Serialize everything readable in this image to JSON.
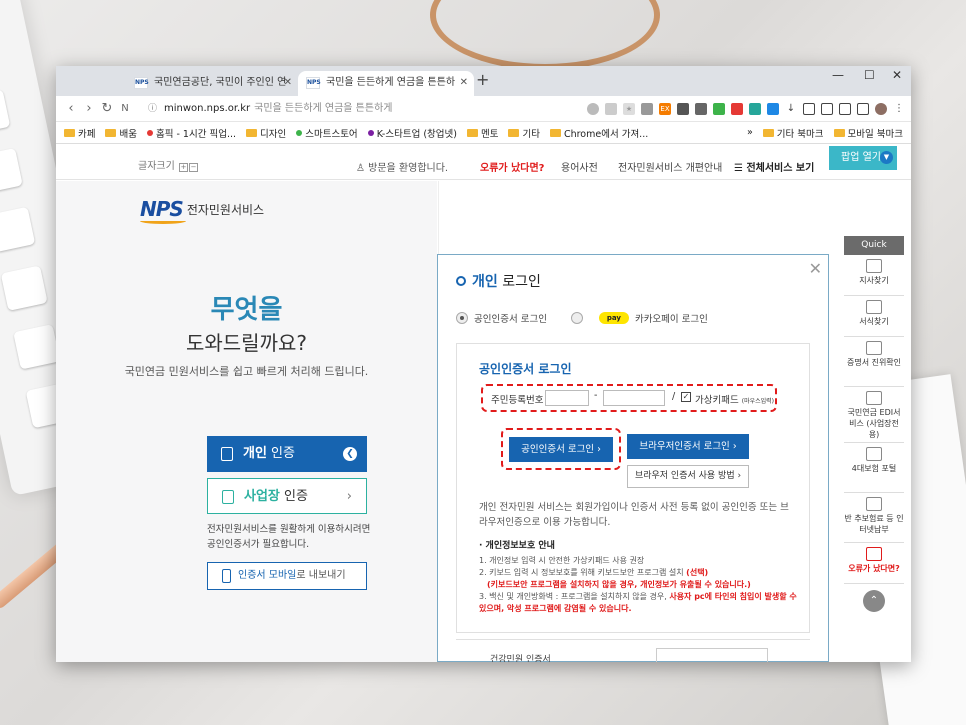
{
  "tabs": [
    {
      "label": "국민연금공단, 국민이 주인인 연",
      "active": false
    },
    {
      "label": "국민을 든든하게 연금을 튼튼하",
      "active": true
    }
  ],
  "toolbar": {
    "url": "minwon.nps.or.kr",
    "page_title_hint": "국민을 든든하게 연금을 튼튼하게"
  },
  "bookmarks": [
    {
      "label": "카페",
      "icon": "folder-icon"
    },
    {
      "label": "배움",
      "icon": "folder-icon"
    },
    {
      "label": "홈픽 - 1시간 픽업...",
      "icon": "dot-icon"
    },
    {
      "label": "디자인",
      "icon": "folder-icon"
    },
    {
      "label": "스마트스토어",
      "icon": "dot-icon"
    },
    {
      "label": "K-스타트업 (창업넷)",
      "icon": "dot-icon"
    },
    {
      "label": "멘토",
      "icon": "folder-icon"
    },
    {
      "label": "기타",
      "icon": "folder-icon"
    },
    {
      "label": "Chrome에서 가져...",
      "icon": "folder-icon"
    }
  ],
  "bookmarks_right": [
    {
      "label": "»"
    },
    {
      "label": "기타 북마크"
    },
    {
      "label": "모바일 북마크"
    }
  ],
  "topbar": {
    "font_size_label": "글자크기",
    "welcome": "방문을 환영합니다.",
    "error_link": "오류가 났다면?",
    "dictionary": "용어사전",
    "guide": "전자민원서비스 개편안내",
    "all_services": "전체서비스 보기",
    "popup_open": "팝업 열기"
  },
  "left": {
    "logo_mark": "NPS",
    "logo_text": "전자민원서비스",
    "hero_line1": "무엇을",
    "hero_line2": "도와드릴까요?",
    "hero_desc": "국민연금 민원서비스를 쉽고 빠르게 처리해 드립니다.",
    "personal_bold": "개인",
    "personal_rest": " 인증",
    "business_bold": "사업장",
    "business_rest": " 인증",
    "note_line1": "전자민원서비스를 원활하게 이용하시려면",
    "note_line2": "공인인증서가 필요합니다.",
    "mobile_bold": "인증서 모바일",
    "mobile_rest": "로 내보내기"
  },
  "modal": {
    "title_bold": "개인",
    "title_rest": " 로그인",
    "radio_cert": "공인인증서 로그인",
    "radio_kakao": "카카오페이 로그인",
    "kakao_badge": "pay",
    "section_title": "공인인증서 로그인",
    "rrn_label": "주민등록번호",
    "rrn_dash": "-",
    "rrn_slash": "/",
    "virtual_keypad": "가상키패드",
    "virtual_keypad_note": "(마우스입력)",
    "cert_login_btn": "공인인증서 로그인 ›",
    "browser_login_btn": "브라우저인증서 로그인 ›",
    "browser_how_btn": "브라우저 인증서 사용 방법 ›",
    "desc": "개인 전자민원 서비스는 회원가입이나 인증서 사전 등록 없이 공인인증 또는 브라우저인증으로 이용 가능합니다.",
    "privacy_head": "· 개인정보보호 안내",
    "privacy_1": "1. 개인정보 입력 시 안전한 가상키패드 사용 권장",
    "privacy_2a": "2. 키보드 입력 시 정보보호를 위해 키보드보안 프로그램 설치 ",
    "privacy_2b": "(선택)",
    "privacy_2c": "(키보드보안 프로그램을 설치하지 않을 경우, 개인정보가 유출될 수 있습니다.)",
    "privacy_3a": "3. 백신 및 개인방화벽 : 프로그램을 설치하지 않을 경우, ",
    "privacy_3b": "사용자 pc에 타인의 침입이 발생할 수 있으며, 악성 프로그램에 감염될 수 있습니다.",
    "next_label": "건강민원 인증서"
  },
  "quick": {
    "head": "Quick",
    "items": [
      {
        "label": "지사찾기",
        "icon": "map-icon"
      },
      {
        "label": "서식찾기",
        "icon": "document-search-icon"
      },
      {
        "label": "증명서 진위확인",
        "icon": "certificate-icon"
      },
      {
        "label": "국민연금 EDI서비스 (사업장전용)",
        "icon": "edi-icon"
      },
      {
        "label": "4대보험 포털",
        "icon": "portal-icon"
      },
      {
        "label": "반 추보험료 등 인터넷납부",
        "icon": "payment-icon"
      },
      {
        "label": "오류가 났다면?",
        "icon": "error-icon"
      }
    ],
    "top_btn": "⌃"
  }
}
